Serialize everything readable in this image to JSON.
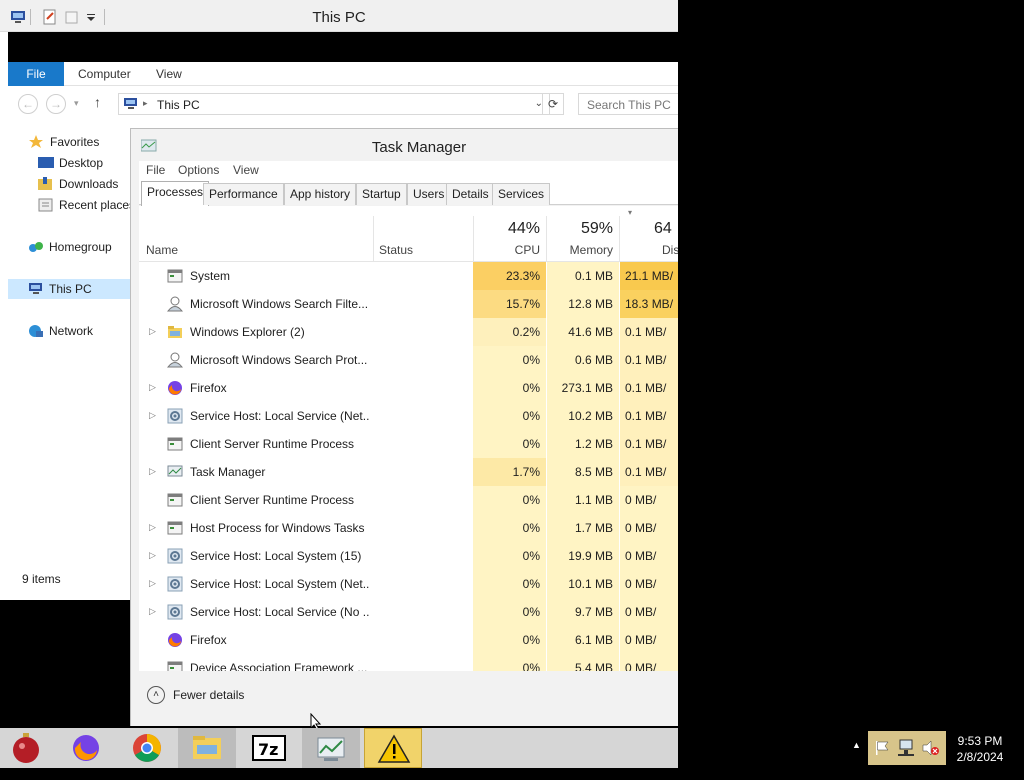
{
  "explorer": {
    "title": "This PC",
    "ribbon_tabs": {
      "file": "File",
      "computer": "Computer",
      "view": "View"
    },
    "address": "This PC",
    "search_placeholder": "Search This PC",
    "nav": {
      "favorites": "Favorites",
      "desktop": "Desktop",
      "downloads": "Downloads",
      "recent": "Recent places",
      "homegroup": "Homegroup",
      "this_pc": "This PC",
      "network": "Network"
    },
    "status": "9 items"
  },
  "task_manager": {
    "title": "Task Manager",
    "menu": {
      "file": "File",
      "options": "Options",
      "view": "View"
    },
    "tabs": {
      "processes": "Processes",
      "performance": "Performance",
      "app_history": "App history",
      "startup": "Startup",
      "users": "Users",
      "details": "Details",
      "services": "Services"
    },
    "columns": {
      "name": "Name",
      "status": "Status",
      "cpu": "CPU",
      "memory": "Memory",
      "disk": "Dis",
      "cpu_pct": "44%",
      "memory_pct": "59%",
      "disk_pct": "64"
    },
    "rows": [
      {
        "name": "System",
        "cpu": "23.3%",
        "memory": "0.1 MB",
        "disk": "21.1 MB/"
      },
      {
        "name": "Microsoft Windows Search Filte...",
        "cpu": "15.7%",
        "memory": "12.8 MB",
        "disk": "18.3 MB/"
      },
      {
        "name": "Windows Explorer (2)",
        "cpu": "0.2%",
        "memory": "41.6 MB",
        "disk": "0.1 MB/"
      },
      {
        "name": "Microsoft Windows Search Prot...",
        "cpu": "0%",
        "memory": "0.6 MB",
        "disk": "0.1 MB/"
      },
      {
        "name": "Firefox",
        "cpu": "0%",
        "memory": "273.1 MB",
        "disk": "0.1 MB/"
      },
      {
        "name": "Service Host: Local Service (Net...",
        "cpu": "0%",
        "memory": "10.2 MB",
        "disk": "0.1 MB/"
      },
      {
        "name": "Client Server Runtime Process",
        "cpu": "0%",
        "memory": "1.2 MB",
        "disk": "0.1 MB/"
      },
      {
        "name": "Task Manager",
        "cpu": "1.7%",
        "memory": "8.5 MB",
        "disk": "0.1 MB/"
      },
      {
        "name": "Client Server Runtime Process",
        "cpu": "0%",
        "memory": "1.1 MB",
        "disk": "0 MB/"
      },
      {
        "name": "Host Process for Windows Tasks",
        "cpu": "0%",
        "memory": "1.7 MB",
        "disk": "0 MB/"
      },
      {
        "name": "Service Host: Local System (15)",
        "cpu": "0%",
        "memory": "19.9 MB",
        "disk": "0 MB/"
      },
      {
        "name": "Service Host: Local System (Net...",
        "cpu": "0%",
        "memory": "10.1 MB",
        "disk": "0 MB/"
      },
      {
        "name": "Service Host: Local Service (No ...",
        "cpu": "0%",
        "memory": "9.7 MB",
        "disk": "0 MB/"
      },
      {
        "name": "Firefox",
        "cpu": "0%",
        "memory": "6.1 MB",
        "disk": "0 MB/"
      },
      {
        "name": "Device Association Framework ...",
        "cpu": "0%",
        "memory": "5.4 MB",
        "disk": "0 MB/"
      }
    ],
    "footer": "Fewer details"
  },
  "tray": {
    "time": "9:53 PM",
    "date": "2/8/2024"
  }
}
